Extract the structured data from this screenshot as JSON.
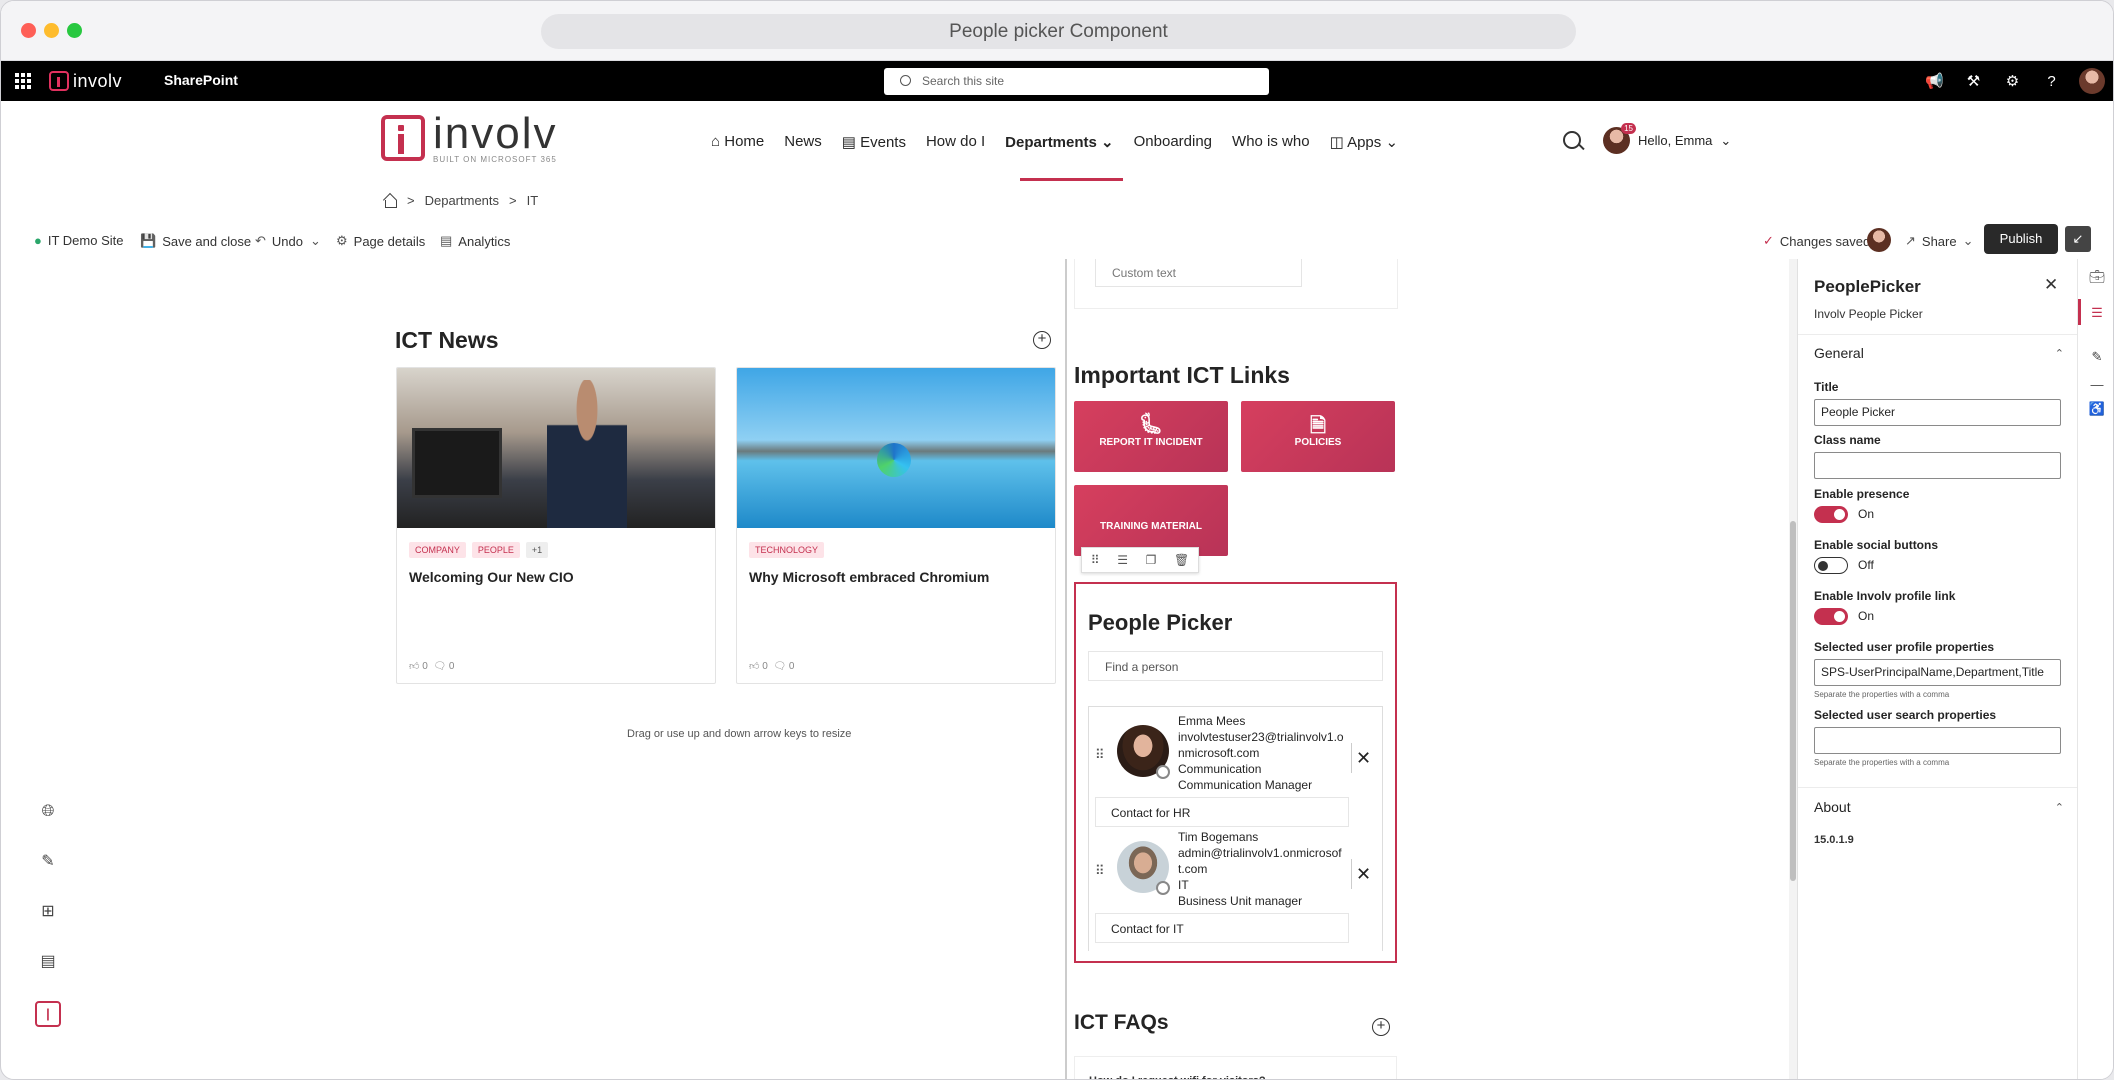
{
  "window": {
    "title": "People picker Component"
  },
  "suite": {
    "logo_text": "involv",
    "app": "SharePoint",
    "search_placeholder": "Search this site"
  },
  "site": {
    "logo_word": "involv",
    "logo_sub": "BUILT ON MICROSOFT 365",
    "nav": [
      "Home",
      "News",
      "Events",
      "How do I",
      "Departments",
      "Onboarding",
      "Who is who",
      "Apps"
    ],
    "active_nav": "Departments",
    "user_greeting": "Hello, Emma",
    "notification_count": "15"
  },
  "breadcrumb": {
    "sep": ">",
    "items": [
      "Departments",
      "IT"
    ]
  },
  "commandbar": {
    "site": "IT Demo Site",
    "save_close": "Save and close",
    "undo": "Undo",
    "page_details": "Page details",
    "analytics": "Analytics",
    "changes_saved": "Changes saved",
    "share": "Share",
    "publish": "Publish"
  },
  "news": {
    "title": "ICT News",
    "cards": [
      {
        "tags": [
          "COMPANY",
          "PEOPLE",
          "+1"
        ],
        "title": "Welcoming Our New CIO",
        "likes": "0",
        "comments": "0"
      },
      {
        "tags": [
          "TECHNOLOGY"
        ],
        "title": "Why Microsoft embraced Chromium",
        "likes": "0",
        "comments": "0"
      }
    ],
    "resize_hint": "Drag or use up and down arrow keys to resize"
  },
  "custom_text": "Custom text",
  "links": {
    "title": "Important ICT Links",
    "tiles": [
      "REPORT IT INCIDENT",
      "POLICIES",
      "TRAINING MATERIAL"
    ]
  },
  "people_picker": {
    "title": "People Picker",
    "find_placeholder": "Find a person",
    "people": [
      {
        "name": "Emma Mees",
        "email_1": "involvtestuser23@trialinvolv1.o",
        "email_2": "nmicrosoft.com",
        "department": "Communication",
        "job": "Communication Manager",
        "contact": "Contact for HR"
      },
      {
        "name": "Tim Bogemans",
        "email_1": "admin@trialinvolv1.onmicrosof",
        "email_2": "t.com",
        "department": "IT",
        "job": "Business Unit manager",
        "contact": "Contact for IT"
      }
    ]
  },
  "faq": {
    "title": "ICT FAQs",
    "first_item": "How do I request wifi for visitors?"
  },
  "pane": {
    "title": "PeoplePicker",
    "subtitle": "Involv People Picker",
    "general": "General",
    "title_label": "Title",
    "title_value": "People Picker",
    "class_label": "Class name",
    "class_value": "",
    "presence_label": "Enable presence",
    "presence_state": "On",
    "social_label": "Enable social buttons",
    "social_state": "Off",
    "profile_label": "Enable Involv profile link",
    "profile_state": "On",
    "props_label": "Selected user profile properties",
    "props_value": "SPS-UserPrincipalName,Department,Title",
    "props_hint": "Separate the properties with a comma",
    "search_label": "Selected user search properties",
    "search_value": "",
    "search_hint": "Separate the properties with a comma",
    "about": "About",
    "version": "15.0.1.9"
  }
}
